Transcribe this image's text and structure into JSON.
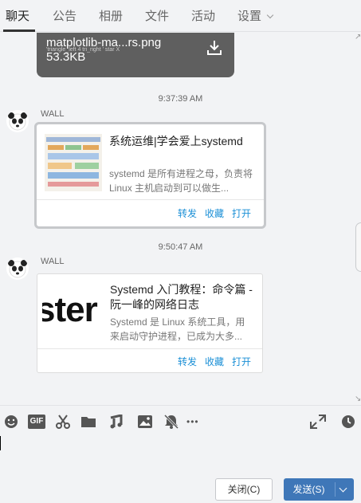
{
  "tabs": [
    {
      "label": "聊天",
      "active": true
    },
    {
      "label": "公告"
    },
    {
      "label": "相册"
    },
    {
      "label": "文件"
    },
    {
      "label": "活动"
    },
    {
      "label": "设置"
    }
  ],
  "file_message": {
    "filename": "matplotlib-ma...rs.png",
    "size": "53.3KB",
    "strip_text": "'triangle_left    4  tri_right        ' star               X"
  },
  "messages": [
    {
      "time": "9:37:39 AM",
      "sender": "WALL",
      "title": "系统运维|学会爱上systemd",
      "desc": "systemd 是所有进程之母，负责将 Linux 主机启动到可以做生...",
      "actions": [
        "转发",
        "收藏",
        "打开"
      ]
    },
    {
      "time": "9:50:47 AM",
      "sender": "WALL",
      "title": "Systemd 入门教程：命令篇 - 阮一峰的网络日志",
      "desc": "Systemd 是 Linux 系统工具，用来启动守护进程，已成为大多...",
      "thumb_text": "ster",
      "actions": [
        "转发",
        "收藏",
        "打开"
      ]
    }
  ],
  "toolbar": {
    "icons": [
      "emoji-icon",
      "gif-icon",
      "scissors-icon",
      "folder-icon",
      "music-icon",
      "image-icon",
      "bell-off-icon",
      "more-icon"
    ],
    "gif_label": "GIF",
    "more_label": "•••"
  },
  "buttons": {
    "close_label": "关闭(C)",
    "send_label": "发送(S)"
  },
  "colors": {
    "accent": "#1a8fd6",
    "send_button": "#3f77b8"
  }
}
